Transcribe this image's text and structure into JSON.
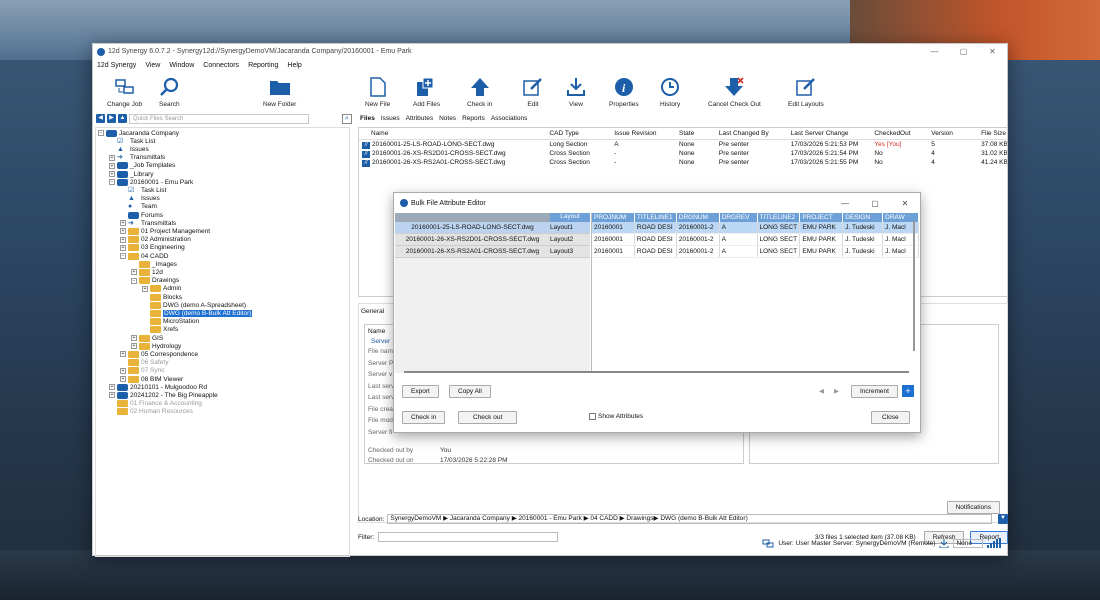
{
  "window": {
    "title": "12d Synergy 6.0.7.2 - Synergy12d://SynergyDemoVM/Jacaranda Company/20160001 - Emu Park",
    "controls": [
      "—",
      "▢",
      "✕"
    ]
  },
  "menu": [
    "12d Synergy",
    "View",
    "Window",
    "Connectors",
    "Reporting",
    "Help"
  ],
  "ribbon": {
    "change_job": "Change Job",
    "search": "Search",
    "new_folder": "New Folder",
    "new_file": "New File",
    "add_files": "Add Files",
    "check_in": "Check in",
    "edit": "Edit",
    "view": "View",
    "properties": "Properties",
    "history": "History",
    "cancel_checkout": "Cancel Check Out",
    "edit_layouts": "Edit Layouts"
  },
  "left": {
    "quick_search": "Quick Files Search",
    "tree": [
      {
        "label": "Jacaranda Company",
        "icon": "srv",
        "lvl": 0,
        "ex": "−"
      },
      {
        "label": "Task List",
        "icon": "task",
        "lvl": 1
      },
      {
        "label": "Issues",
        "icon": "issue",
        "lvl": 1
      },
      {
        "label": "Transmittals",
        "icon": "arrow",
        "lvl": 1,
        "ex": "+"
      },
      {
        "label": "_Job Templates",
        "icon": "srv",
        "lvl": 1,
        "ex": "+"
      },
      {
        "label": "_Library",
        "icon": "srv",
        "lvl": 1,
        "ex": "+"
      },
      {
        "label": "20160001 - Emu Park",
        "icon": "srv",
        "lvl": 1,
        "ex": "−"
      },
      {
        "label": "Task List",
        "icon": "task",
        "lvl": 2
      },
      {
        "label": "Issues",
        "icon": "issue",
        "lvl": 2
      },
      {
        "label": "Team",
        "icon": "team",
        "lvl": 2
      },
      {
        "label": "Forums",
        "icon": "srv",
        "lvl": 2
      },
      {
        "label": "Transmittals",
        "icon": "arrow",
        "lvl": 2,
        "ex": "+"
      },
      {
        "label": "01 Project Management",
        "icon": "fold",
        "lvl": 2,
        "ex": "+"
      },
      {
        "label": "02 Administration",
        "icon": "fold",
        "lvl": 2,
        "ex": "+"
      },
      {
        "label": "03 Engineering",
        "icon": "fold",
        "lvl": 2,
        "ex": "+"
      },
      {
        "label": "04 CADD",
        "icon": "fold",
        "lvl": 2,
        "ex": "−"
      },
      {
        "label": "_Images",
        "icon": "fold",
        "lvl": 3
      },
      {
        "label": "12d",
        "icon": "fold",
        "lvl": 3,
        "ex": "+"
      },
      {
        "label": "Drawings",
        "icon": "fold",
        "lvl": 3,
        "ex": "−"
      },
      {
        "label": "Admin",
        "icon": "fold",
        "lvl": 4,
        "ex": "+"
      },
      {
        "label": "Blocks",
        "icon": "fold",
        "lvl": 4
      },
      {
        "label": "DWG (demo A-Spreadsheet)",
        "icon": "fold",
        "lvl": 4
      },
      {
        "label": "DWG (demo B-Bulk Att Editor)",
        "icon": "fold",
        "lvl": 4,
        "sel": true
      },
      {
        "label": "MicroStation",
        "icon": "fold",
        "lvl": 4
      },
      {
        "label": "Xrefs",
        "icon": "fold",
        "lvl": 4
      },
      {
        "label": "GIS",
        "icon": "fold",
        "lvl": 3,
        "ex": "+"
      },
      {
        "label": "Hydrology",
        "icon": "fold",
        "lvl": 3,
        "ex": "+"
      },
      {
        "label": "05 Correspondence",
        "icon": "fold",
        "lvl": 2,
        "ex": "+"
      },
      {
        "label": "06 Safety",
        "icon": "fold",
        "lvl": 2,
        "dim": true
      },
      {
        "label": "07 Sync",
        "icon": "fold",
        "lvl": 2,
        "ex": "+",
        "dim": true
      },
      {
        "label": "08 BIM Viewer",
        "icon": "fold",
        "lvl": 2,
        "ex": "+"
      },
      {
        "label": "20210101 - Mulgoodoo Rd",
        "icon": "srv",
        "lvl": 1,
        "ex": "+"
      },
      {
        "label": "20241202 - The Big Pineapple",
        "icon": "srv",
        "lvl": 1,
        "ex": "+"
      },
      {
        "label": "01 Finance & Accounting",
        "icon": "fold",
        "lvl": 1,
        "dim": true
      },
      {
        "label": "02 Human Resources",
        "icon": "fold",
        "lvl": 1,
        "dim": true
      }
    ]
  },
  "tabs": [
    "Files",
    "Issues",
    "Attributes",
    "Notes",
    "Reports",
    "Associations"
  ],
  "files": {
    "headers": [
      "Name",
      "CAD Type",
      "Issue Revision",
      "State",
      "Last Changed By",
      "Last Server Change",
      "CheckedOut",
      "Version",
      "File Size"
    ],
    "rows": [
      [
        "20160001-25-LS-ROAD-LONG-SECT.dwg",
        "Long Section",
        "A",
        "None",
        "Pre senter",
        "17/03/2026 5:21:53 PM",
        "Yes [You]",
        "5",
        "37.08 KB"
      ],
      [
        "20160001-26-XS-RS2D01-CROSS-SECT.dwg",
        "Cross Section",
        "-",
        "None",
        "Pre senter",
        "17/03/2026 5:21:54 PM",
        "No",
        "4",
        "31.02 KB"
      ],
      [
        "20160001-26-XS-RS2A01-CROSS-SECT.dwg",
        "Cross Section",
        "-",
        "None",
        "Pre senter",
        "17/03/2026 5:21:55 PM",
        "No",
        "4",
        "41.24 KB"
      ]
    ]
  },
  "general": {
    "tab": "General",
    "name_hdr": "Name",
    "server": "Server",
    "rows": [
      "File name",
      "Server P",
      "Server v",
      "Last serv",
      "Last serv",
      "File creat",
      "File modi",
      "Server fi"
    ],
    "checked_out_by": "Checked out by",
    "checked_out_by_val": "You",
    "checked_out_on": "Checked out on",
    "checked_out_on_val": "17/03/2026 5:22:28 PM"
  },
  "notifications": "Notifications",
  "filter": {
    "label": "Filter:",
    "status": "3/3 files   1 selected item (37.08 KB)",
    "refresh": "Refresh",
    "report": "Report"
  },
  "location": {
    "label": "Location:",
    "path": "SynergyDemoVM ▶ Jacaranda Company ▶ 20160001 - Emu Park  ▶ 04 CADD ▶ Drawings▶ DWG (demo B-Bulk Att Editor)"
  },
  "status": {
    "text": "User:  User  Master Server:  SynergyDemoVM (Remote)",
    "none": "None"
  },
  "dialog": {
    "title": "Bulk File Attribute Editor",
    "layout_hdr": "Layout",
    "rows": [
      {
        "file": "20160001-25-LS-ROAD-LONG-SECT.dwg",
        "layout": "Layout1"
      },
      {
        "file": "20160001-26-XS-RS2D01-CROSS-SECT.dwg",
        "layout": "Layout2"
      },
      {
        "file": "20160001-26-XS-RS2A01-CROSS-SECT.dwg",
        "layout": "Layout3"
      }
    ],
    "cols": [
      "PROJNUM",
      "TITLELINE1",
      "DRGNUM",
      "DRGREV",
      "TITLELINE2",
      "PROJECT",
      "DESIGN",
      "DRAW"
    ],
    "vals": [
      [
        "20160001",
        "ROAD DESI",
        "20160001-2",
        "A",
        "LONG SECT",
        "EMU PARK",
        "J. Tudeski",
        "J. Macl"
      ],
      [
        "20160001",
        "ROAD DESI",
        "20160001-2",
        "A",
        "LONG SECT",
        "EMU PARK",
        "J. Tudeski",
        "J. Macl"
      ],
      [
        "20160001",
        "ROAD DESI",
        "20160001-2",
        "A",
        "LONG SECT",
        "EMU PARK",
        "J. Tudeski",
        "J. Macl"
      ]
    ],
    "export": "Export",
    "copy_all": "Copy All",
    "check_in": "Check in",
    "check_out": "Check out",
    "show_attrs": "Show Attributes",
    "increment": "Increment",
    "close": "Close"
  }
}
